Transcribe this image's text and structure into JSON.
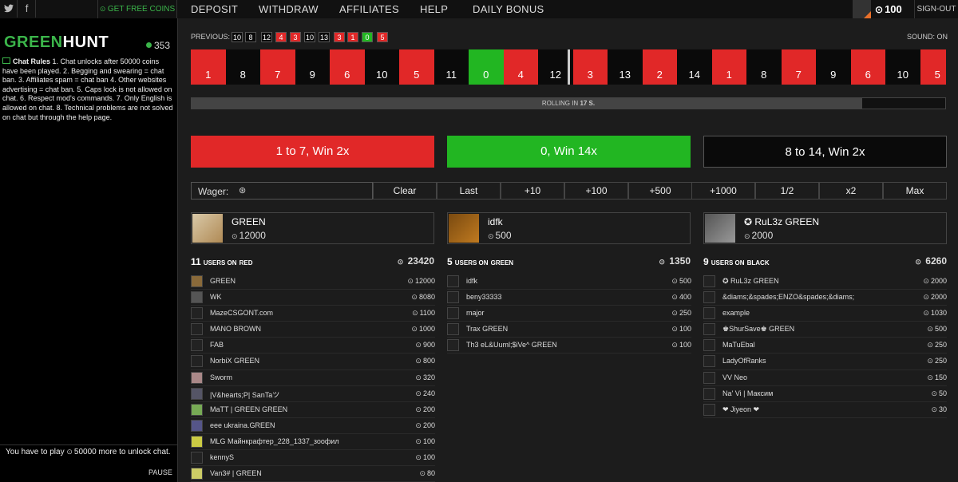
{
  "top": {
    "twitter": "twitter-icon",
    "facebook": "f",
    "get_free": "GET FREE COINS",
    "nav": [
      "DEPOSIT",
      "WITHDRAW",
      "AFFILIATES",
      "HELP",
      "DAILY BONUS"
    ],
    "coins": "100",
    "signout": "SIGN-OUT"
  },
  "logo": {
    "green": "GREEN",
    "hunt": "HUNT"
  },
  "online": "353",
  "rules": {
    "title": "Chat Rules",
    "text": "1. Chat unlocks after 50000 coins have been played. 2. Begging and swearing = chat ban. 3. Affiliates spam = chat ban 4. Other websites advertising = chat ban. 5. Caps lock is not allowed on chat. 6. Respect mod's commands. 7. Only English is allowed on chat. 8. Technical problems are not solved on chat but through the help page."
  },
  "unlock": {
    "pre": "You have to play",
    "amount": "50000",
    "post": "more to unlock chat.",
    "pause": "PAUSE"
  },
  "previous_label": "PREVIOUS:",
  "previous": [
    {
      "n": "10",
      "c": "b"
    },
    {
      "n": "8",
      "c": "b"
    },
    {
      "n": "12",
      "c": "b"
    },
    {
      "n": "4",
      "c": "r"
    },
    {
      "n": "3",
      "c": "r"
    },
    {
      "n": "10",
      "c": "b"
    },
    {
      "n": "13",
      "c": "b"
    },
    {
      "n": "3",
      "c": "r"
    },
    {
      "n": "1",
      "c": "r"
    },
    {
      "n": "0",
      "c": "g"
    },
    {
      "n": "5",
      "c": "r"
    }
  ],
  "sound": "SOUND: ON",
  "strip": [
    {
      "n": "1",
      "c": "r"
    },
    {
      "n": "8",
      "c": "b"
    },
    {
      "n": "7",
      "c": "r"
    },
    {
      "n": "9",
      "c": "b"
    },
    {
      "n": "6",
      "c": "r"
    },
    {
      "n": "10",
      "c": "b"
    },
    {
      "n": "5",
      "c": "r"
    },
    {
      "n": "11",
      "c": "b"
    },
    {
      "n": "0",
      "c": "g"
    },
    {
      "n": "4",
      "c": "r"
    },
    {
      "n": "12",
      "c": "b"
    },
    {
      "n": "3",
      "c": "r"
    },
    {
      "n": "13",
      "c": "b"
    },
    {
      "n": "2",
      "c": "r"
    },
    {
      "n": "14",
      "c": "b"
    },
    {
      "n": "1",
      "c": "r"
    },
    {
      "n": "8",
      "c": "b"
    },
    {
      "n": "7",
      "c": "r"
    },
    {
      "n": "9",
      "c": "b"
    },
    {
      "n": "6",
      "c": "r"
    },
    {
      "n": "10",
      "c": "b"
    },
    {
      "n": "5",
      "c": "r"
    }
  ],
  "rolling": {
    "pre": "ROLLING IN",
    "time": "17 S.",
    "progress": 0.89
  },
  "bets": {
    "red": "1 to 7, Win 2x",
    "green": "0, Win 14x",
    "black": "8 to 14, Win 2x"
  },
  "colors": {
    "red": "#e12828",
    "green": "#22b622",
    "black": "#0a0a0a"
  },
  "wager": {
    "label": "Wager:",
    "buttons": [
      "Clear",
      "Last",
      "+10",
      "+100",
      "+500",
      "+1000",
      "1/2",
      "x2",
      "Max"
    ]
  },
  "columns": [
    {
      "key": "red",
      "top": {
        "name": "GREEN",
        "amount": "12000"
      },
      "count": "11",
      "label_pre": "USERS ON",
      "label_color": "RED",
      "total": "23420",
      "rows": [
        [
          "GREEN",
          "12000"
        ],
        [
          "WK",
          "8080"
        ],
        [
          "MazeCSGONT.com",
          "1100"
        ],
        [
          "MANO BROWN",
          "1000"
        ],
        [
          "FAB",
          "900"
        ],
        [
          "NorbiX GREEN",
          "800"
        ],
        [
          "Sworm",
          "320"
        ],
        [
          "|V&hearts;P| SanTaツ",
          "240"
        ],
        [
          "MaTT | GREEN GREEN",
          "200"
        ],
        [
          "eee ukraina.GREEN",
          "200"
        ],
        [
          "MLG Майнкрафтер_228_1337_зоофил",
          "100"
        ],
        [
          "kennyS",
          "100"
        ],
        [
          "Van3# | GREEN",
          "80"
        ]
      ]
    },
    {
      "key": "green",
      "top": {
        "name": "idfk",
        "amount": "500"
      },
      "count": "5",
      "label_pre": "USERS ON",
      "label_color": "GREEN",
      "total": "1350",
      "rows": [
        [
          "idfk",
          "500"
        ],
        [
          "beny33333",
          "400"
        ],
        [
          "major",
          "250"
        ],
        [
          "Trax GREEN",
          "100"
        ],
        [
          "Th3 eL&Uuml;$iVe^ GREEN",
          "100"
        ]
      ]
    },
    {
      "key": "black",
      "top": {
        "name": "✪ RuL3z GREEN",
        "amount": "2000"
      },
      "count": "9",
      "label_pre": "USERS ON",
      "label_color": "BLACK",
      "total": "6260",
      "rows": [
        [
          "✪ RuL3z GREEN",
          "2000"
        ],
        [
          "&diams;&spades;ENZO&spades;&diams;",
          "2000"
        ],
        [
          "example",
          "1030"
        ],
        [
          "♚ShurSave♚ GREEN",
          "500"
        ],
        [
          "MaTuEbal",
          "250"
        ],
        [
          "LadyOfRanks",
          "250"
        ],
        [
          "VV Neo",
          "150"
        ],
        [
          "Na' Vi | Максим",
          "50"
        ],
        [
          "❤ Jiyeon ❤",
          "30"
        ]
      ]
    }
  ]
}
